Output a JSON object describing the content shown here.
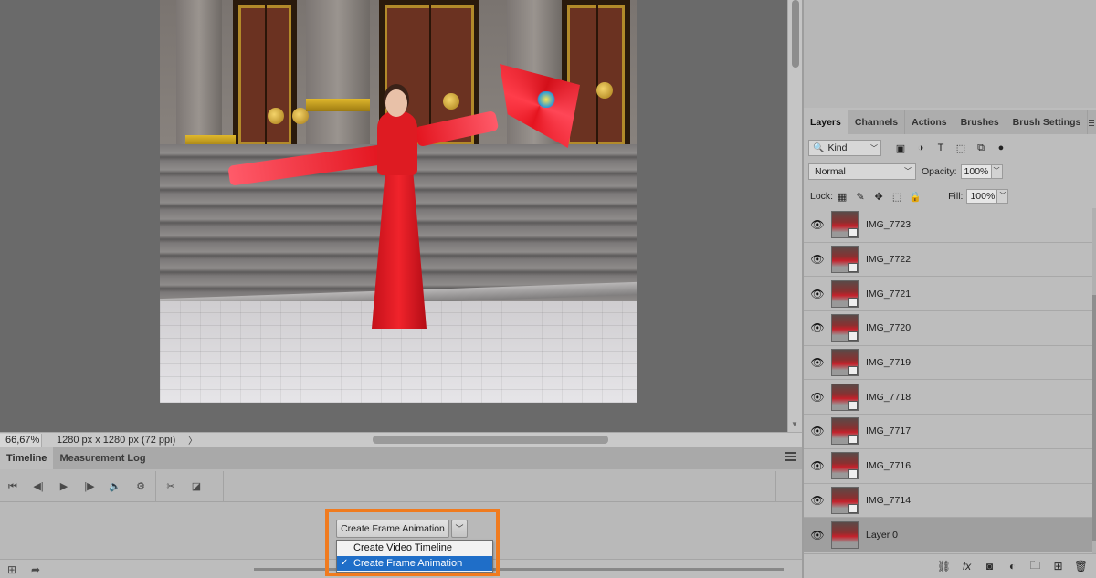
{
  "status_bar": {
    "zoom": "66,67%",
    "doc_info": "1280 px x 1280 px (72 ppi)",
    "arrow": "〉"
  },
  "timeline": {
    "tabs": [
      "Timeline",
      "Measurement Log"
    ],
    "controls": {
      "first_frame": "⏮",
      "prev_frame": "◀|",
      "play": "▶",
      "next_frame": "|▶",
      "audio": "🔈",
      "settings": "⚙",
      "split": "✂",
      "transition": "◪"
    },
    "create_button_label": "Create Frame Animation",
    "dropdown_arrow": "﹀",
    "dropdown_options": [
      {
        "label": "Create Video Timeline",
        "checked": false
      },
      {
        "label": "Create Frame Animation",
        "checked": true
      }
    ],
    "check_mark": "✓"
  },
  "layers_panel": {
    "tabs": [
      "Layers",
      "Channels",
      "Actions",
      "Brushes",
      "Brush Settings"
    ],
    "filter": {
      "icon": "🔍",
      "kind": "Kind"
    },
    "blend_mode": "Normal",
    "opacity_label": "Opacity:",
    "opacity_value": "100%",
    "lock_label": "Lock:",
    "fill_label": "Fill:",
    "fill_value": "100%",
    "layers": [
      {
        "name": "IMG_7723",
        "visible": true
      },
      {
        "name": "IMG_7722",
        "visible": true
      },
      {
        "name": "IMG_7721",
        "visible": true
      },
      {
        "name": "IMG_7720",
        "visible": true
      },
      {
        "name": "IMG_7719",
        "visible": true
      },
      {
        "name": "IMG_7718",
        "visible": true
      },
      {
        "name": "IMG_7717",
        "visible": true
      },
      {
        "name": "IMG_7716",
        "visible": true
      },
      {
        "name": "IMG_7714",
        "visible": true
      },
      {
        "name": "Layer 0",
        "visible": true,
        "active": true
      }
    ]
  },
  "colors": {
    "highlight": "#f07b1f",
    "selection": "#1f6ec8"
  }
}
